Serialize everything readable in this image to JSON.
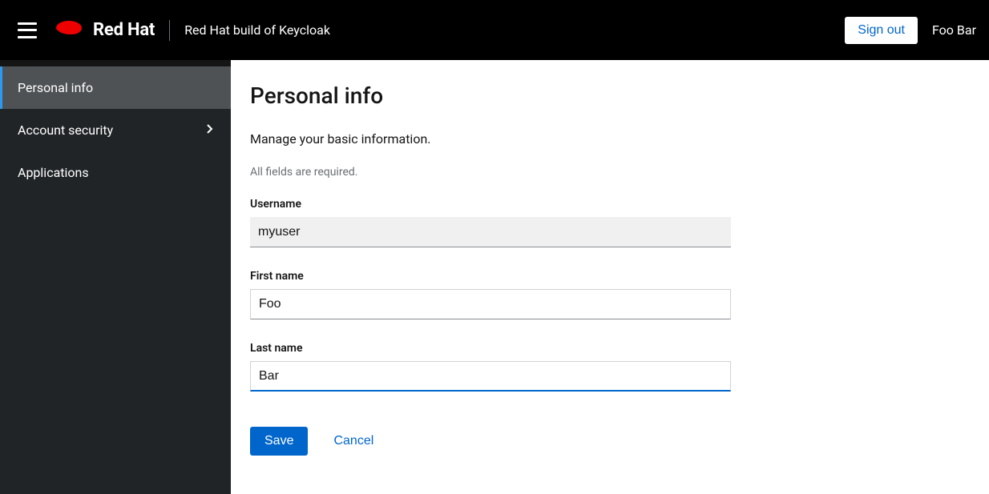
{
  "header": {
    "brand_name": "Red Hat",
    "app_title": "Red Hat build of Keycloak",
    "sign_out_label": "Sign out",
    "user_display_name": "Foo Bar"
  },
  "sidebar": {
    "items": [
      {
        "label": "Personal info",
        "active": true,
        "expandable": false
      },
      {
        "label": "Account security",
        "active": false,
        "expandable": true
      },
      {
        "label": "Applications",
        "active": false,
        "expandable": false
      }
    ]
  },
  "main": {
    "title": "Personal info",
    "subtitle": "Manage your basic information.",
    "required_note": "All fields are required.",
    "fields": {
      "username": {
        "label": "Username",
        "value": "myuser"
      },
      "first_name": {
        "label": "First name",
        "value": "Foo"
      },
      "last_name": {
        "label": "Last name",
        "value": "Bar"
      }
    },
    "actions": {
      "save_label": "Save",
      "cancel_label": "Cancel"
    }
  }
}
